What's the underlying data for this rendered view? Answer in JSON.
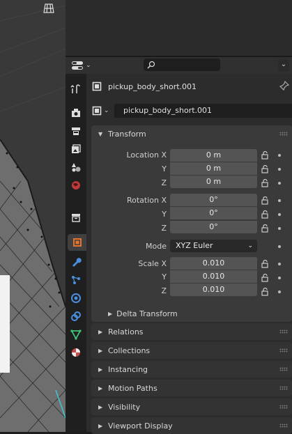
{
  "object_name": "pickup_body_short.001",
  "data_name": "pickup_body_short.001",
  "transform": {
    "title": "Transform",
    "location": {
      "label_x": "Location X",
      "label_y": "Y",
      "label_z": "Z",
      "x": "0 m",
      "y": "0 m",
      "z": "0 m"
    },
    "rotation": {
      "label_x": "Rotation X",
      "label_y": "Y",
      "label_z": "Z",
      "x": "0°",
      "y": "0°",
      "z": "0°"
    },
    "mode_label": "Mode",
    "mode_value": "XYZ Euler",
    "scale": {
      "label_x": "Scale X",
      "label_y": "Y",
      "label_z": "Z",
      "x": "0.010",
      "y": "0.010",
      "z": "0.010"
    },
    "delta": "Delta Transform"
  },
  "sections": [
    "Relations",
    "Collections",
    "Instancing",
    "Motion Paths",
    "Visibility",
    "Viewport Display"
  ],
  "tabs": [
    "tool",
    "render",
    "output",
    "view-layer",
    "scene",
    "world",
    "collection",
    "object",
    "modifier",
    "particles",
    "physics",
    "constraints",
    "data",
    "material"
  ],
  "colors": {
    "accent": "#e8742c",
    "panel": "#2c2c2c",
    "field": "#545454"
  }
}
